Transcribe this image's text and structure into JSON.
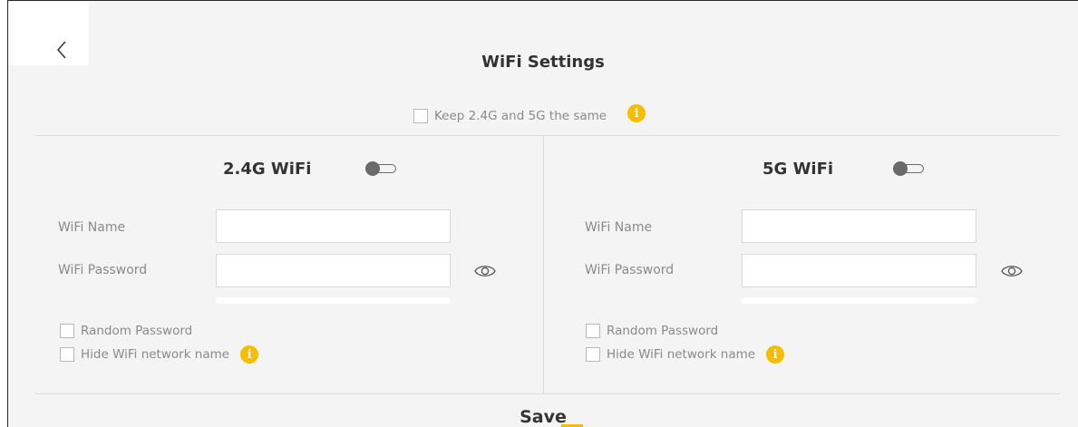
{
  "header": {
    "title": "WiFi Settings",
    "back_icon": "chevron-left-icon"
  },
  "keep_same": {
    "label": "Keep 2.4G and 5G the same",
    "checked": false,
    "info_icon": "info-icon"
  },
  "band_24g": {
    "title": "2.4G WiFi",
    "enabled": false,
    "wifi_name_label": "WiFi Name",
    "wifi_name_value": "",
    "wifi_password_label": "WiFi Password",
    "wifi_password_value": "",
    "random_password_label": "Random Password",
    "random_password_checked": false,
    "hide_name_label": "Hide WiFi network name",
    "hide_name_checked": false
  },
  "band_5g": {
    "title": "5G WiFi",
    "enabled": false,
    "wifi_name_label": "WiFi Name",
    "wifi_name_value": "",
    "wifi_password_label": "WiFi Password",
    "wifi_password_value": "",
    "random_password_label": "Random Password",
    "random_password_checked": false,
    "hide_name_label": "Hide WiFi network name",
    "hide_name_checked": false
  },
  "actions": {
    "save_label": "Save"
  },
  "colors": {
    "accent": "#f6be00",
    "background": "#f4f4f4",
    "toggle_off": "#6a6a6a"
  }
}
